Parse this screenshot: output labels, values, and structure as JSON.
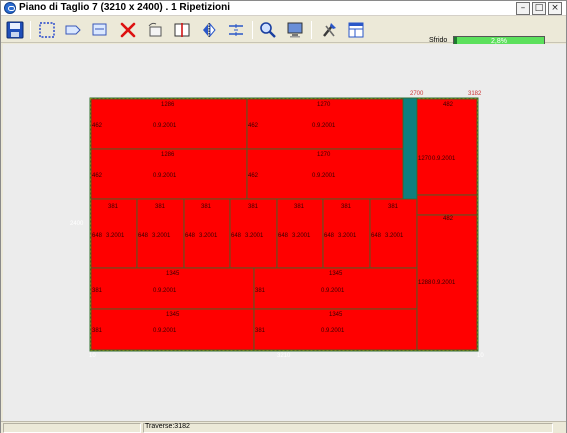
{
  "window": {
    "title": "Piano di Taglio 7  (3210 x 2400)  .  1 Ripetizioni",
    "buttons": {
      "minimize": "–",
      "maximize": "□",
      "close": "×"
    }
  },
  "toolbar": {
    "items": [
      {
        "name": "save-button",
        "icon": "floppy-disk-icon"
      },
      {
        "name": "select-area-button",
        "icon": "dotted-selection-icon"
      },
      {
        "name": "shape-1-button",
        "icon": "arrow-shape-icon"
      },
      {
        "name": "shape-2-button",
        "icon": "sheet-shape-icon"
      },
      {
        "name": "delete-button",
        "icon": "red-x-icon"
      },
      {
        "name": "rotate-button",
        "icon": "rotate-sheet-icon"
      },
      {
        "name": "vertical-split-button",
        "icon": "vertical-cut-icon"
      },
      {
        "name": "mirror-button",
        "icon": "mirror-icon"
      },
      {
        "name": "horizontal-split-button",
        "icon": "horizontal-cut-icon"
      },
      {
        "name": "zoom-button",
        "icon": "magnifier-icon"
      },
      {
        "name": "monitor-button",
        "icon": "monitor-icon"
      },
      {
        "name": "tools-button",
        "icon": "tools-icon"
      },
      {
        "name": "layout-button",
        "icon": "grid-layout-icon"
      }
    ]
  },
  "sfrido": {
    "label": "Sfrido",
    "value_text": "2,8%",
    "value": 0.028,
    "bar_color": "#5ce05c",
    "fill_color": "#1e7a2e"
  },
  "plan": {
    "sheet_width": 3210,
    "sheet_height": 2400,
    "colors": {
      "piece": "#ff0000",
      "waste": "#0f7f7f",
      "outline": "#2f6f2f",
      "dashed": "#f0d000"
    },
    "top_dims": [
      "2700",
      "3182"
    ],
    "left_dim": "2400",
    "bottom_dim": "3210",
    "origin_bottom": "10",
    "origin_top": "10",
    "pieces": [
      {
        "id": "r1a",
        "w": "1286",
        "h": "462",
        "size": "0.9.2001"
      },
      {
        "id": "r1b",
        "w": "1270",
        "h": "462",
        "size": "0.9.2001"
      },
      {
        "id": "r2a",
        "w": "1286",
        "h": "462",
        "size": "0.9.2001"
      },
      {
        "id": "r2b",
        "w": "1270",
        "h": "462",
        "size": "0.9.2001"
      },
      {
        "id": "r3a",
        "w": "381",
        "h": "648",
        "size": "3.2001"
      },
      {
        "id": "r3b",
        "w": "381",
        "h": "648",
        "size": "3.2001"
      },
      {
        "id": "r3c",
        "w": "381",
        "h": "648",
        "size": "3.2001"
      },
      {
        "id": "r3d",
        "w": "381",
        "h": "648",
        "size": "3.2001"
      },
      {
        "id": "r3e",
        "w": "381",
        "h": "648",
        "size": "3.2001"
      },
      {
        "id": "r3f",
        "w": "381",
        "h": "648",
        "size": "3.2001"
      },
      {
        "id": "r3g",
        "w": "381",
        "h": "648",
        "size": "3.2001"
      },
      {
        "id": "r4a",
        "w": "1345",
        "h": "381",
        "size": "0.9.2001"
      },
      {
        "id": "r4b",
        "w": "1345",
        "h": "381",
        "size": "0.9.2001"
      },
      {
        "id": "r5a",
        "w": "1345",
        "h": "381",
        "size": "0.9.2001"
      },
      {
        "id": "r5b",
        "w": "1345",
        "h": "381",
        "size": "0.9.2001"
      },
      {
        "id": "side-top",
        "w": "482",
        "h": "1270",
        "size": "0.9.2001"
      },
      {
        "id": "side-mid",
        "w": "",
        "h": "482",
        "size": ""
      },
      {
        "id": "side-bot",
        "w": "",
        "h": "1288",
        "size": "0.9.2001"
      }
    ]
  },
  "status": {
    "traverse": "Traverse:3182"
  }
}
